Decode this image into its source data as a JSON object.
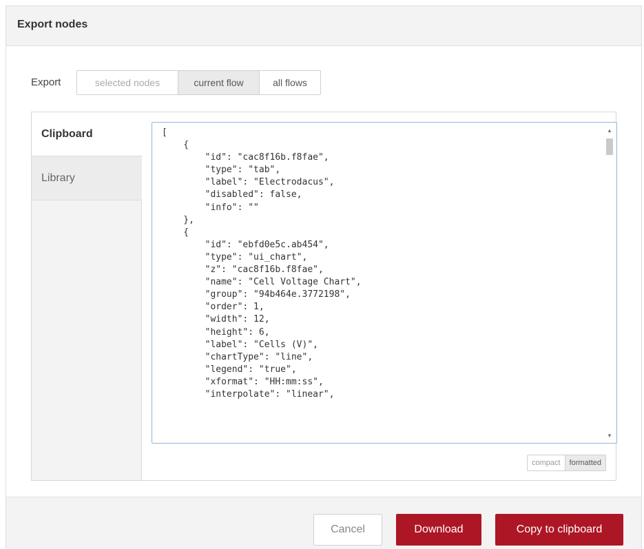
{
  "dialog": {
    "title": "Export nodes"
  },
  "export": {
    "label": "Export",
    "options": [
      "selected nodes",
      "current flow",
      "all flows"
    ]
  },
  "sidebar": {
    "tabs": [
      "Clipboard",
      "Library"
    ]
  },
  "code": {
    "content": "[\n    {\n        \"id\": \"cac8f16b.f8fae\",\n        \"type\": \"tab\",\n        \"label\": \"Electrodacus\",\n        \"disabled\": false,\n        \"info\": \"\"\n    },\n    {\n        \"id\": \"ebfd0e5c.ab454\",\n        \"type\": \"ui_chart\",\n        \"z\": \"cac8f16b.f8fae\",\n        \"name\": \"Cell Voltage Chart\",\n        \"group\": \"94b464e.3772198\",\n        \"order\": 1,\n        \"width\": 12,\n        \"height\": 6,\n        \"label\": \"Cells (V)\",\n        \"chartType\": \"line\",\n        \"legend\": \"true\",\n        \"xformat\": \"HH:mm:ss\",\n        \"interpolate\": \"linear\","
  },
  "format": {
    "compact_label": "compact",
    "formatted_label": "formatted"
  },
  "footer": {
    "cancel_label": "Cancel",
    "download_label": "Download",
    "copy_label": "Copy to clipboard"
  },
  "colors": {
    "primary_button": "#ad1625",
    "header_bg": "#f3f3f3"
  },
  "icons": {
    "scroll_up": "triangle-up",
    "scroll_down": "triangle-down"
  }
}
